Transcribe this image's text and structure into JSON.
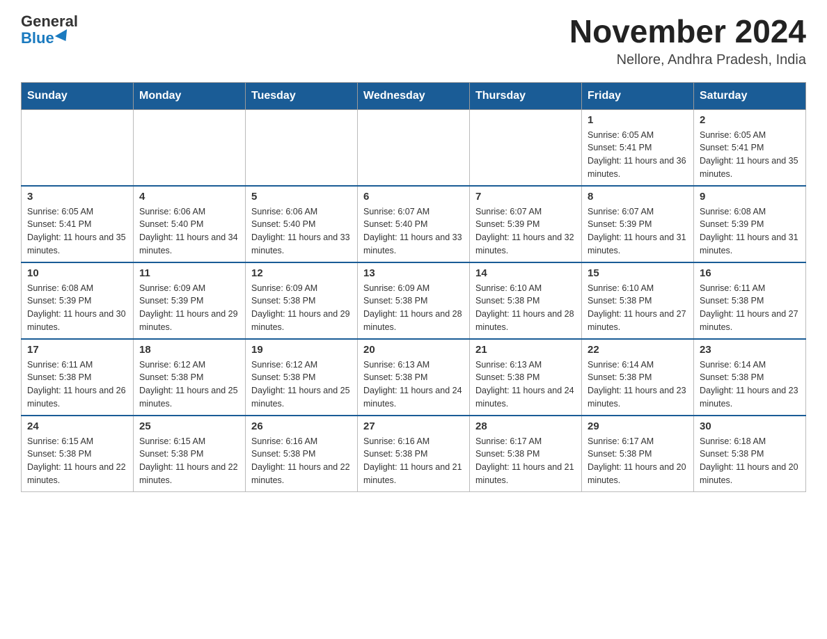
{
  "header": {
    "logo_general": "General",
    "logo_blue": "Blue",
    "month_title": "November 2024",
    "location": "Nellore, Andhra Pradesh, India"
  },
  "days_of_week": [
    "Sunday",
    "Monday",
    "Tuesday",
    "Wednesday",
    "Thursday",
    "Friday",
    "Saturday"
  ],
  "weeks": [
    [
      {
        "day": "",
        "info": ""
      },
      {
        "day": "",
        "info": ""
      },
      {
        "day": "",
        "info": ""
      },
      {
        "day": "",
        "info": ""
      },
      {
        "day": "",
        "info": ""
      },
      {
        "day": "1",
        "info": "Sunrise: 6:05 AM\nSunset: 5:41 PM\nDaylight: 11 hours and 36 minutes."
      },
      {
        "day": "2",
        "info": "Sunrise: 6:05 AM\nSunset: 5:41 PM\nDaylight: 11 hours and 35 minutes."
      }
    ],
    [
      {
        "day": "3",
        "info": "Sunrise: 6:05 AM\nSunset: 5:41 PM\nDaylight: 11 hours and 35 minutes."
      },
      {
        "day": "4",
        "info": "Sunrise: 6:06 AM\nSunset: 5:40 PM\nDaylight: 11 hours and 34 minutes."
      },
      {
        "day": "5",
        "info": "Sunrise: 6:06 AM\nSunset: 5:40 PM\nDaylight: 11 hours and 33 minutes."
      },
      {
        "day": "6",
        "info": "Sunrise: 6:07 AM\nSunset: 5:40 PM\nDaylight: 11 hours and 33 minutes."
      },
      {
        "day": "7",
        "info": "Sunrise: 6:07 AM\nSunset: 5:39 PM\nDaylight: 11 hours and 32 minutes."
      },
      {
        "day": "8",
        "info": "Sunrise: 6:07 AM\nSunset: 5:39 PM\nDaylight: 11 hours and 31 minutes."
      },
      {
        "day": "9",
        "info": "Sunrise: 6:08 AM\nSunset: 5:39 PM\nDaylight: 11 hours and 31 minutes."
      }
    ],
    [
      {
        "day": "10",
        "info": "Sunrise: 6:08 AM\nSunset: 5:39 PM\nDaylight: 11 hours and 30 minutes."
      },
      {
        "day": "11",
        "info": "Sunrise: 6:09 AM\nSunset: 5:39 PM\nDaylight: 11 hours and 29 minutes."
      },
      {
        "day": "12",
        "info": "Sunrise: 6:09 AM\nSunset: 5:38 PM\nDaylight: 11 hours and 29 minutes."
      },
      {
        "day": "13",
        "info": "Sunrise: 6:09 AM\nSunset: 5:38 PM\nDaylight: 11 hours and 28 minutes."
      },
      {
        "day": "14",
        "info": "Sunrise: 6:10 AM\nSunset: 5:38 PM\nDaylight: 11 hours and 28 minutes."
      },
      {
        "day": "15",
        "info": "Sunrise: 6:10 AM\nSunset: 5:38 PM\nDaylight: 11 hours and 27 minutes."
      },
      {
        "day": "16",
        "info": "Sunrise: 6:11 AM\nSunset: 5:38 PM\nDaylight: 11 hours and 27 minutes."
      }
    ],
    [
      {
        "day": "17",
        "info": "Sunrise: 6:11 AM\nSunset: 5:38 PM\nDaylight: 11 hours and 26 minutes."
      },
      {
        "day": "18",
        "info": "Sunrise: 6:12 AM\nSunset: 5:38 PM\nDaylight: 11 hours and 25 minutes."
      },
      {
        "day": "19",
        "info": "Sunrise: 6:12 AM\nSunset: 5:38 PM\nDaylight: 11 hours and 25 minutes."
      },
      {
        "day": "20",
        "info": "Sunrise: 6:13 AM\nSunset: 5:38 PM\nDaylight: 11 hours and 24 minutes."
      },
      {
        "day": "21",
        "info": "Sunrise: 6:13 AM\nSunset: 5:38 PM\nDaylight: 11 hours and 24 minutes."
      },
      {
        "day": "22",
        "info": "Sunrise: 6:14 AM\nSunset: 5:38 PM\nDaylight: 11 hours and 23 minutes."
      },
      {
        "day": "23",
        "info": "Sunrise: 6:14 AM\nSunset: 5:38 PM\nDaylight: 11 hours and 23 minutes."
      }
    ],
    [
      {
        "day": "24",
        "info": "Sunrise: 6:15 AM\nSunset: 5:38 PM\nDaylight: 11 hours and 22 minutes."
      },
      {
        "day": "25",
        "info": "Sunrise: 6:15 AM\nSunset: 5:38 PM\nDaylight: 11 hours and 22 minutes."
      },
      {
        "day": "26",
        "info": "Sunrise: 6:16 AM\nSunset: 5:38 PM\nDaylight: 11 hours and 22 minutes."
      },
      {
        "day": "27",
        "info": "Sunrise: 6:16 AM\nSunset: 5:38 PM\nDaylight: 11 hours and 21 minutes."
      },
      {
        "day": "28",
        "info": "Sunrise: 6:17 AM\nSunset: 5:38 PM\nDaylight: 11 hours and 21 minutes."
      },
      {
        "day": "29",
        "info": "Sunrise: 6:17 AM\nSunset: 5:38 PM\nDaylight: 11 hours and 20 minutes."
      },
      {
        "day": "30",
        "info": "Sunrise: 6:18 AM\nSunset: 5:38 PM\nDaylight: 11 hours and 20 minutes."
      }
    ]
  ]
}
